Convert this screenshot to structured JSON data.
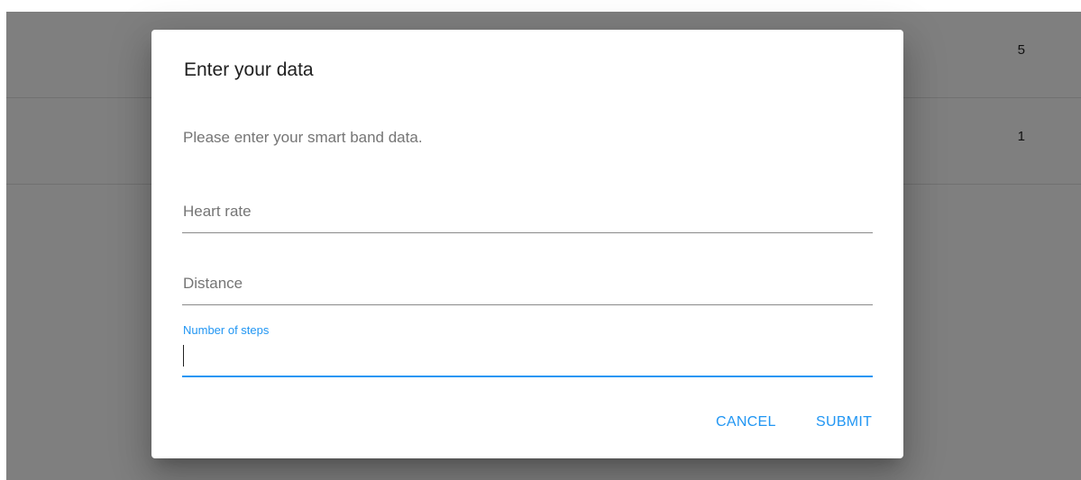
{
  "background_table": {
    "rows": [
      {
        "value": "5"
      },
      {
        "value": "1"
      }
    ]
  },
  "dialog": {
    "title": "Enter your data",
    "description": "Please enter your smart band data.",
    "fields": {
      "heart_rate": {
        "label": "Heart rate",
        "value": ""
      },
      "distance": {
        "label": "Distance",
        "value": ""
      },
      "steps": {
        "label": "Number of steps",
        "value": "",
        "focused": true
      }
    },
    "actions": {
      "cancel_label": "CANCEL",
      "submit_label": "SUBMIT"
    }
  },
  "colors": {
    "accent": "#2196f3",
    "backdrop": "rgba(0,0,0,0.5)",
    "text_primary": "#212121",
    "text_secondary": "#757575"
  }
}
